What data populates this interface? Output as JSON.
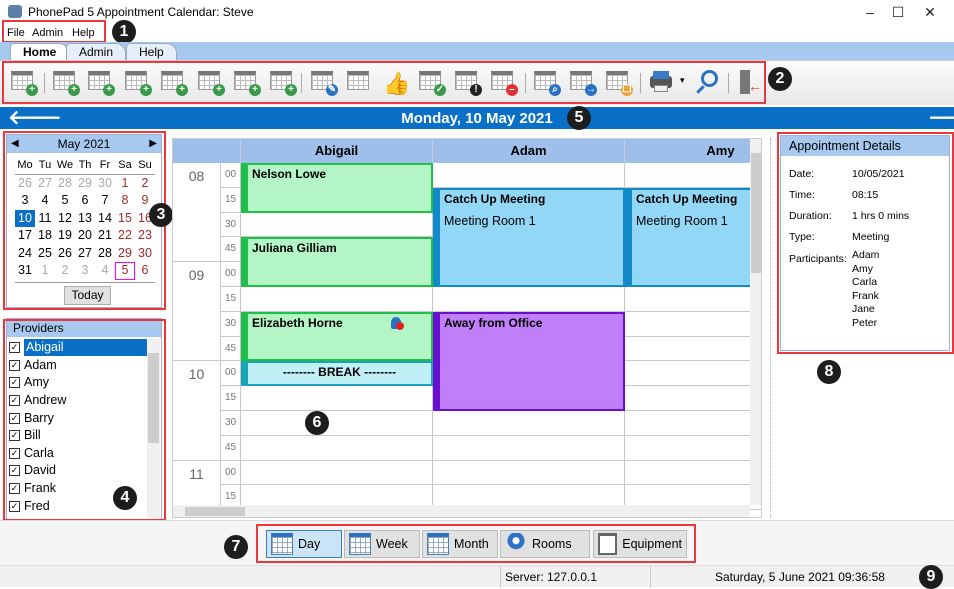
{
  "window": {
    "title": "PhonePad 5 Appointment Calendar: Steve",
    "minimize": "–",
    "maximize": "☐",
    "close": "✕"
  },
  "menu": [
    "File",
    "Admin",
    "Help"
  ],
  "ribbon_tabs": [
    {
      "label": "Home",
      "active": true
    },
    {
      "label": "Admin"
    },
    {
      "label": "Help"
    }
  ],
  "toolbar": [
    {
      "icon": "new-appointment-icon",
      "badge": "+",
      "color": "#3a9a4a"
    },
    {
      "icon": "new-client-appointment-icon",
      "badge": "+",
      "color": "#3a9a4a"
    },
    {
      "icon": "new-client-icon",
      "badge": "+",
      "color": "#3a9a4a"
    },
    {
      "icon": "new-group-icon",
      "badge": "+",
      "color": "#3a9a4a"
    },
    {
      "icon": "new-block-icon",
      "badge": "+",
      "color": "#3a9a4a"
    },
    {
      "icon": "new-leave-icon",
      "badge": "+",
      "color": "#3a9a4a"
    },
    {
      "icon": "new-lunch-icon",
      "badge": "+",
      "color": "#3a9a4a"
    },
    {
      "icon": "new-travel-icon",
      "badge": "+",
      "color": "#3a9a4a"
    },
    {
      "icon": "edit-appointment-icon",
      "badge": "✎",
      "color": "#2b72c4"
    },
    {
      "icon": "open-appointment-icon",
      "badge": "",
      "color": ""
    },
    {
      "icon": "thumbs-up-icon",
      "badge": "",
      "color": ""
    },
    {
      "icon": "confirm-appointment-icon",
      "badge": "✓",
      "color": "#3a9a4a"
    },
    {
      "icon": "flag-appointment-icon",
      "badge": "!",
      "color": "#222"
    },
    {
      "icon": "cancel-appointment-icon",
      "badge": "–",
      "color": "#d33"
    },
    {
      "icon": "find-appointment-icon",
      "badge": "⌕",
      "color": "#2b72c4"
    },
    {
      "icon": "move-appointment-icon",
      "badge": "→",
      "color": "#2b72c4"
    },
    {
      "icon": "copy-appointment-icon",
      "badge": "❐",
      "color": "#e8a43a"
    },
    {
      "icon": "print-icon",
      "badge": "",
      "color": ""
    },
    {
      "icon": "search-icon",
      "badge": "",
      "color": ""
    },
    {
      "icon": "exit-icon",
      "badge": "",
      "color": ""
    }
  ],
  "datebar": {
    "date": "Monday, 10 May 2021",
    "prev": "🡐",
    "next": "🡒"
  },
  "mini_calendar": {
    "month": "May 2021",
    "prev": "◀",
    "next": "▶",
    "dow": [
      "Mo",
      "Tu",
      "We",
      "Th",
      "Fr",
      "Sa",
      "Su"
    ],
    "weeks": [
      [
        "26",
        "27",
        "28",
        "29",
        "30",
        "1",
        "2"
      ],
      [
        "3",
        "4",
        "5",
        "6",
        "7",
        "8",
        "9"
      ],
      [
        "10",
        "11",
        "12",
        "13",
        "14",
        "15",
        "16"
      ],
      [
        "17",
        "18",
        "19",
        "20",
        "21",
        "22",
        "23"
      ],
      [
        "24",
        "25",
        "26",
        "27",
        "28",
        "29",
        "30"
      ],
      [
        "31",
        "1",
        "2",
        "3",
        "4",
        "5",
        "6"
      ]
    ],
    "selected": "10",
    "today": "5",
    "today_button": "Today"
  },
  "providers": {
    "title": "Providers",
    "items": [
      "Abigail",
      "Adam",
      "Amy",
      "Andrew",
      "Barry",
      "Bill",
      "Carla",
      "David",
      "Frank",
      "Fred"
    ],
    "selected": "Abigail"
  },
  "schedule": {
    "columns": [
      "Abigail",
      "Adam",
      "Amy"
    ],
    "hours": [
      "08",
      "09",
      "10",
      "11"
    ],
    "minutes": [
      "00",
      "15",
      "30",
      "45"
    ],
    "appointments": [
      {
        "col": 0,
        "start": "08:00",
        "end": "08:30",
        "title": "Nelson Lowe",
        "type": "client",
        "color": "#b3f5c5",
        "border": "#1fbf4a"
      },
      {
        "col": 0,
        "start": "08:45",
        "end": "09:15",
        "title": "Juliana Gilliam",
        "type": "client",
        "color": "#b3f5c5",
        "border": "#1fbf4a"
      },
      {
        "col": 0,
        "start": "09:30",
        "end": "10:00",
        "title": "Elizabeth Horne",
        "type": "client",
        "color": "#b3f5c5",
        "border": "#1fbf4a",
        "icon": "client-alert-icon"
      },
      {
        "col": 0,
        "start": "10:00",
        "end": "10:15",
        "title": "-------- BREAK --------",
        "type": "break",
        "color": "#c0f0f5",
        "border": "#1aa3b8"
      },
      {
        "col": 1,
        "start": "08:15",
        "end": "09:15",
        "title": "Catch Up Meeting",
        "subtitle": "Meeting Room 1",
        "type": "meeting",
        "color": "#93d7f7",
        "border": "#1289c9"
      },
      {
        "col": 2,
        "start": "08:15",
        "end": "09:15",
        "title": "Catch Up Meeting",
        "subtitle": "Meeting Room 1",
        "type": "meeting",
        "color": "#93d7f7",
        "border": "#1289c9"
      },
      {
        "col": 1,
        "start": "09:30",
        "end": "10:30",
        "title": "Away from Office",
        "type": "away",
        "color": "#c07ef9",
        "border": "#6a0fd0"
      }
    ]
  },
  "details": {
    "title": "Appointment Details",
    "rows": [
      {
        "label": "Date:",
        "value": "10/05/2021"
      },
      {
        "label": "Time:",
        "value": "08:15"
      },
      {
        "label": "Duration:",
        "value": "1 hrs 0 mins"
      },
      {
        "label": "Type:",
        "value": "Meeting"
      }
    ],
    "participants_label": "Participants:",
    "participants": [
      "Adam",
      "Amy",
      "Carla",
      "Frank",
      "Jane",
      "Peter"
    ]
  },
  "views": [
    {
      "label": "Day",
      "icon": "day-calendar-icon",
      "selected": true
    },
    {
      "label": "Week",
      "icon": "week-calendar-icon"
    },
    {
      "label": "Month",
      "icon": "month-calendar-icon"
    },
    {
      "label": "Rooms",
      "icon": "map-pin-icon"
    },
    {
      "label": "Equipment",
      "icon": "projector-screen-icon"
    }
  ],
  "status": {
    "server": "Server: 127.0.0.1",
    "datetime": "Saturday, 5 June 2021  09:36:58"
  },
  "callouts": [
    "1",
    "2",
    "3",
    "4",
    "5",
    "6",
    "7",
    "8",
    "9"
  ]
}
